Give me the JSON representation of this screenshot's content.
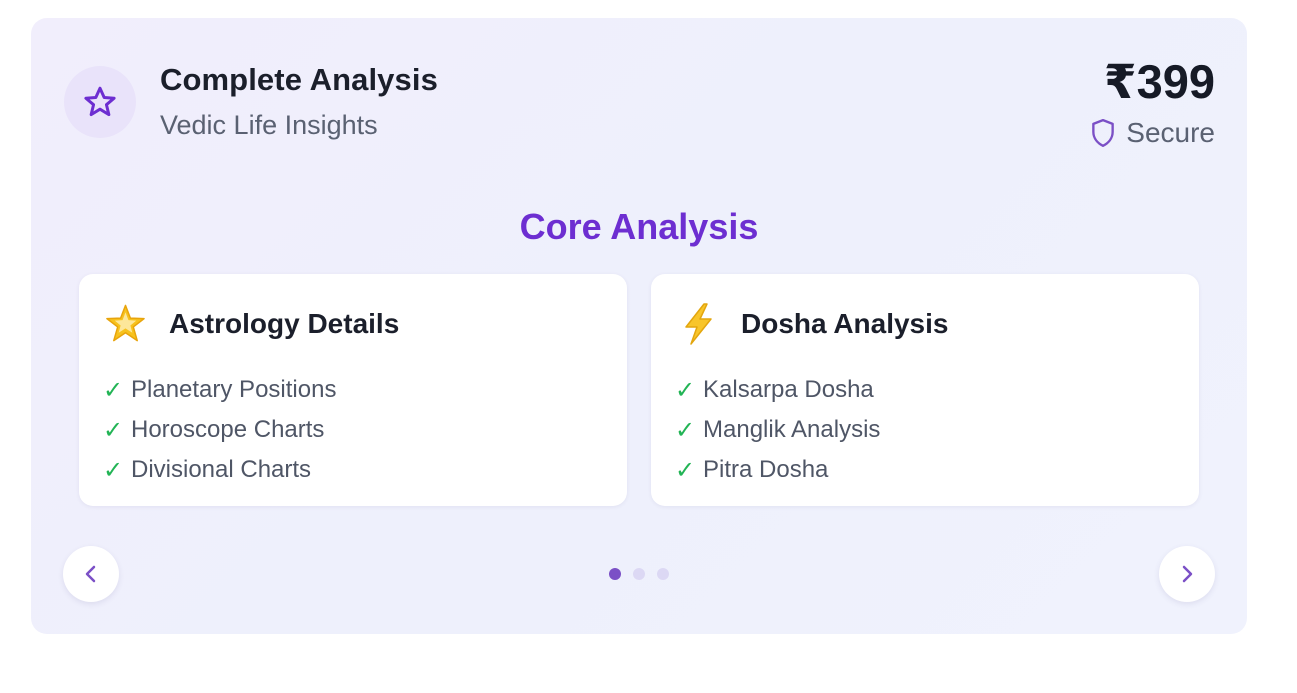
{
  "header": {
    "title": "Complete Analysis",
    "subtitle": "Vedic Life Insights",
    "icon": "star-icon",
    "price": "₹399",
    "secure_label": "Secure",
    "secure_icon": "shield-icon"
  },
  "section": {
    "title": "Core Analysis"
  },
  "features": [
    {
      "emoji": "glowing-star-icon",
      "title": "Astrology Details",
      "items": [
        "Planetary Positions",
        "Horoscope Charts",
        "Divisional Charts"
      ]
    },
    {
      "emoji": "lightning-icon",
      "title": "Dosha Analysis",
      "items": [
        "Kalsarpa Dosha",
        "Manglik Analysis",
        "Pitra Dosha"
      ]
    }
  ],
  "carousel": {
    "page_count": 3,
    "active_page": 1
  },
  "colors": {
    "accent": "#6d2ed1",
    "check": "#22b455",
    "dot_active": "#7b50c6",
    "dot_inactive": "#dcd8f4"
  }
}
